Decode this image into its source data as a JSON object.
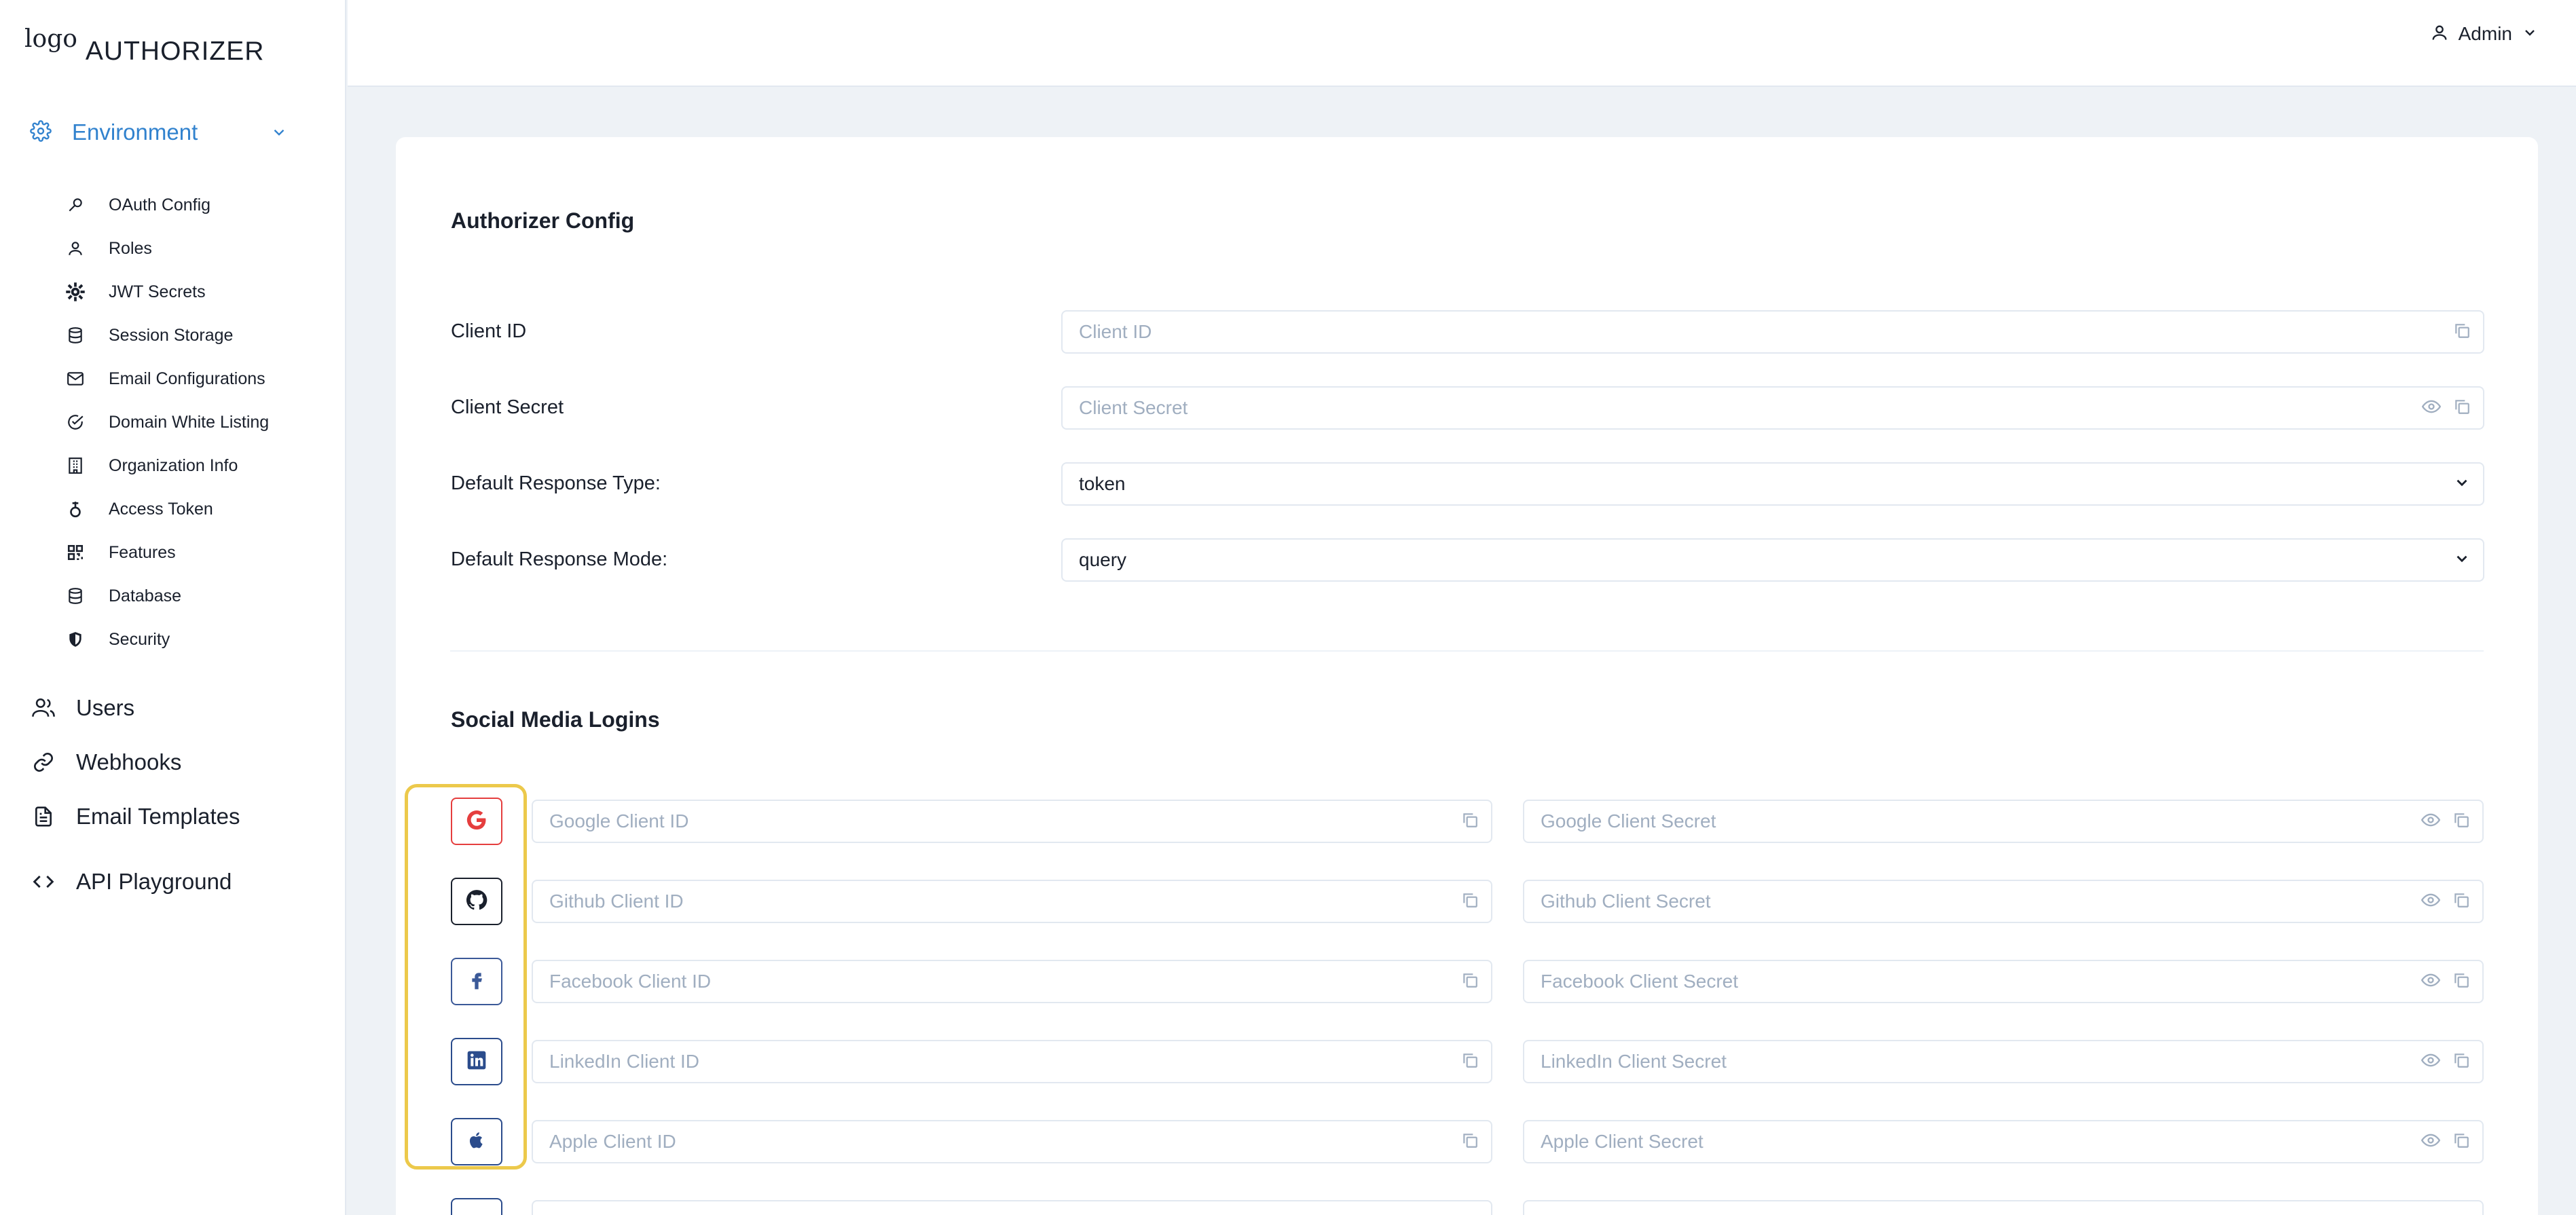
{
  "brand": {
    "logo_alt": "logo",
    "name": "AUTHORIZER"
  },
  "sidebar": {
    "environment_label": "Environment",
    "env_items": [
      {
        "label": "OAuth Config",
        "icon": "key-icon"
      },
      {
        "label": "Roles",
        "icon": "user-icon"
      },
      {
        "label": "JWT Secrets",
        "icon": "gear-icon"
      },
      {
        "label": "Session Storage",
        "icon": "database-icon"
      },
      {
        "label": "Email Configurations",
        "icon": "mail-icon"
      },
      {
        "label": "Domain White Listing",
        "icon": "check-circle-icon"
      },
      {
        "label": "Organization Info",
        "icon": "building-icon"
      },
      {
        "label": "Access Token",
        "icon": "token-icon"
      },
      {
        "label": "Features",
        "icon": "grid-icon"
      },
      {
        "label": "Database",
        "icon": "database-icon"
      },
      {
        "label": "Security",
        "icon": "shield-icon"
      }
    ],
    "main_items": [
      {
        "label": "Users",
        "icon": "users-icon"
      },
      {
        "label": "Webhooks",
        "icon": "link-icon"
      },
      {
        "label": "Email Templates",
        "icon": "document-icon"
      },
      {
        "label": "API Playground",
        "icon": "code-icon"
      }
    ]
  },
  "header": {
    "user_label": "Admin"
  },
  "config": {
    "title": "Authorizer Config",
    "client_id_label": "Client ID",
    "client_id_placeholder": "Client ID",
    "client_secret_label": "Client Secret",
    "client_secret_placeholder": "Client Secret",
    "response_type_label": "Default Response Type:",
    "response_type_value": "token",
    "response_mode_label": "Default Response Mode:",
    "response_mode_value": "query"
  },
  "social": {
    "title": "Social Media Logins",
    "providers": [
      {
        "name": "google",
        "id_placeholder": "Google Client ID",
        "secret_placeholder": "Google Client Secret",
        "color": "#e53e3e"
      },
      {
        "name": "github",
        "id_placeholder": "Github Client ID",
        "secret_placeholder": "Github Client Secret",
        "color": "#1a202c"
      },
      {
        "name": "facebook",
        "id_placeholder": "Facebook Client ID",
        "secret_placeholder": "Facebook Client Secret",
        "color": "#3b5998"
      },
      {
        "name": "linkedin",
        "id_placeholder": "LinkedIn Client ID",
        "secret_placeholder": "LinkedIn Client Secret",
        "color": "#2b4c8c"
      },
      {
        "name": "apple",
        "id_placeholder": "Apple Client ID",
        "secret_placeholder": "Apple Client Secret",
        "color": "#2b4c8c"
      }
    ]
  },
  "colors": {
    "accent": "#3182ce",
    "highlight": "#ecc94b",
    "background": "#eef2f6"
  }
}
